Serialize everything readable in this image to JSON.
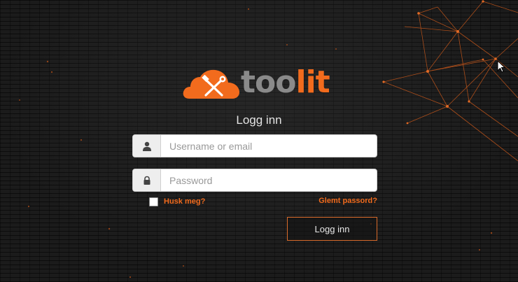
{
  "brand": {
    "name_part1": "too",
    "name_part2": "lit",
    "logo_icon": "tools-cloud-icon"
  },
  "form": {
    "title": "Logg inn",
    "username": {
      "placeholder": "Username or email",
      "icon": "user-icon"
    },
    "password": {
      "placeholder": "Password",
      "icon": "lock-icon"
    },
    "remember_label": "Husk meg?",
    "forgot_label": "Glemt passord?",
    "submit_label": "Logg inn"
  },
  "colors": {
    "accent": "#f26b1d",
    "background": "#1b1b1b",
    "logo_gray": "#8a8a8a"
  }
}
